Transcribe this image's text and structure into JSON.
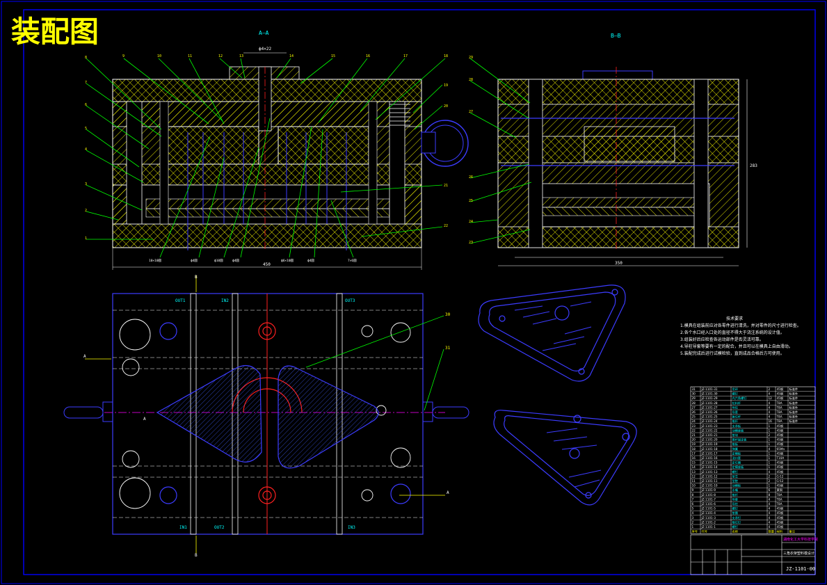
{
  "drawing": {
    "title": "装配图",
    "section_aa_label": "A—A",
    "section_bb_label": "B—B",
    "drawing_number": "JZ-1101-00",
    "school": "湖南化工大学科技学院",
    "product_name": "三角衣架塑料模设计"
  },
  "dimensions": {
    "width_450": "450",
    "width_350": "350",
    "height_283": "283",
    "top_feed": "ϕ4×22"
  },
  "callouts_left": [
    "8",
    "7",
    "6",
    "5",
    "4",
    "3",
    "2",
    "1"
  ],
  "callouts_top": [
    "9",
    "10",
    "11",
    "12",
    "13",
    "14",
    "15",
    "16",
    "17",
    "18"
  ],
  "callouts_right_aa": [
    "19",
    "20",
    "21",
    "22"
  ],
  "callouts_bb": [
    "23",
    "24",
    "25",
    "26",
    "27",
    "28",
    "29"
  ],
  "bottom_dims": [
    "10×10圆",
    "ϕ4圆",
    "ϕ10圆",
    "ϕ4圆",
    "ϕ6×10圆",
    "ϕ4圆",
    "7×6圆"
  ],
  "plan_labels": {
    "out1": "OUT1",
    "in2": "IN2",
    "out3": "OUT3",
    "in1": "IN1",
    "out2": "OUT2",
    "in3": "IN3",
    "sec_a": "A",
    "sec_b": "B",
    "callout_30": "30",
    "callout_31": "31"
  },
  "tech_requirements": {
    "heading": "技术要求",
    "items": [
      "1.模具在组装前应对各零件进行清洗，并对零件的尺寸进行检查。",
      "2.各个水口经入口处的直径不得大于浇注系统的设计值。",
      "3.组装好后应检查各运动部件是否灵活可靠。",
      "4.导柱导套等要有一定的配合，并且可以在模具上自由滑动。",
      "5.装配完成后进行试模检验，直到成品合格后方可使用。"
    ]
  },
  "bom": {
    "header": [
      "序号",
      "代号",
      "名称",
      "数量",
      "材料",
      "备注"
    ],
    "rows": [
      [
        "31",
        "JZ-1101-31",
        "吊环",
        "2",
        "45钢",
        "标准件"
      ],
      [
        "30",
        "JZ-1101-30",
        "螺钉",
        "4",
        "45钢",
        "标准件"
      ],
      [
        "29",
        "JZ-1101-29",
        "内六角螺钉",
        "12",
        "45钢",
        "标准件"
      ],
      [
        "28",
        "JZ-1101-28",
        "拉料杆",
        "4",
        "T8A",
        "标准件"
      ],
      [
        "27",
        "JZ-1101-27",
        "导柱",
        "4",
        "T8A",
        "标准件"
      ],
      [
        "26",
        "JZ-1101-26",
        "导套",
        "4",
        "T8A",
        "标准件"
      ],
      [
        "25",
        "JZ-1101-25",
        "复位杆",
        "4",
        "T8A",
        "标准件"
      ],
      [
        "24",
        "JZ-1101-24",
        "推杆",
        "16",
        "T8A",
        "标准件"
      ],
      [
        "23",
        "JZ-1101-23",
        "支承板",
        "1",
        "45钢",
        ""
      ],
      [
        "22",
        "JZ-1101-22",
        "动模座板",
        "1",
        "45钢",
        ""
      ],
      [
        "21",
        "JZ-1101-21",
        "垫块",
        "2",
        "45钢",
        ""
      ],
      [
        "20",
        "JZ-1101-20",
        "推杆固定板",
        "1",
        "45钢",
        ""
      ],
      [
        "19",
        "JZ-1101-19",
        "推板",
        "1",
        "45钢",
        ""
      ],
      [
        "18",
        "JZ-1101-18",
        "弹簧",
        "4",
        "65Mn",
        ""
      ],
      [
        "17",
        "JZ-1101-17",
        "定模板",
        "1",
        "45钢",
        ""
      ],
      [
        "16",
        "JZ-1101-16",
        "浇口套",
        "1",
        "T10A",
        ""
      ],
      [
        "15",
        "JZ-1101-15",
        "定位圈",
        "1",
        "45钢",
        ""
      ],
      [
        "14",
        "JZ-1101-14",
        "定模座板",
        "1",
        "45钢",
        ""
      ],
      [
        "13",
        "JZ-1101-13",
        "螺钉",
        "4",
        "45钢",
        ""
      ],
      [
        "12",
        "JZ-1101-12",
        "型芯",
        "2",
        "Cr12",
        ""
      ],
      [
        "11",
        "JZ-1101-11",
        "型腔",
        "2",
        "Cr12",
        ""
      ],
      [
        "10",
        "JZ-1101-10",
        "动模板",
        "1",
        "45钢",
        ""
      ],
      [
        "9",
        "JZ-1101-9",
        "水嘴",
        "6",
        "黄铜",
        ""
      ],
      [
        "8",
        "JZ-1101-8",
        "推杆",
        "8",
        "T8A",
        ""
      ],
      [
        "7",
        "JZ-1101-7",
        "导套",
        "4",
        "T8A",
        ""
      ],
      [
        "6",
        "JZ-1101-6",
        "导柱",
        "4",
        "T8A",
        ""
      ],
      [
        "5",
        "JZ-1101-5",
        "螺钉",
        "4",
        "45钢",
        ""
      ],
      [
        "4",
        "JZ-1101-4",
        "垫圈",
        "4",
        "45钢",
        ""
      ],
      [
        "3",
        "JZ-1101-3",
        "支承钉",
        "4",
        "45钢",
        ""
      ],
      [
        "2",
        "JZ-1101-2",
        "限位钉",
        "4",
        "45钢",
        ""
      ],
      [
        "1",
        "JZ-1101-1",
        "螺钉",
        "4",
        "45钢",
        ""
      ]
    ]
  },
  "colors": {
    "background": "#000000",
    "border": "#0000ff",
    "section": "#ffffff",
    "hatch": "#ffff00",
    "leader": "#00ff00",
    "blue": "#3c3cff",
    "red": "#ff2020",
    "magenta": "#ff00ff",
    "cyan": "#00ffff",
    "title_yellow": "#ffff00"
  }
}
